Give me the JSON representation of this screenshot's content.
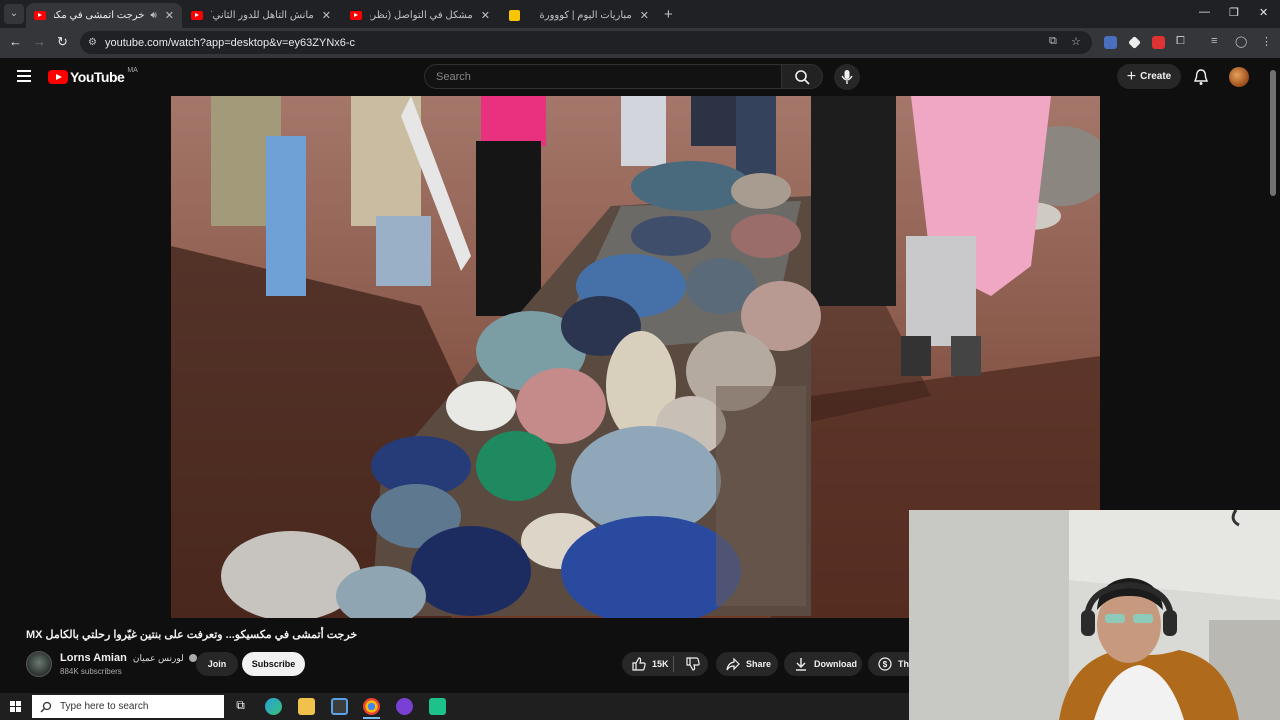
{
  "browser": {
    "tabs": [
      {
        "title": "خرجت أتمشى في مكسيكو...",
        "active": true,
        "icon": "youtube-icon",
        "audio": true
      },
      {
        "title": "مانش التأهل للدور الثاني؟ التشكيل",
        "active": false,
        "icon": "youtube-icon",
        "audio": false
      },
      {
        "title": "مشكل في التواصل (نظرية البراق)",
        "active": false,
        "icon": "youtube-icon",
        "audio": false
      },
      {
        "title": "مباريات اليوم | كووورة",
        "active": false,
        "icon": "kooora-icon",
        "audio": false
      }
    ],
    "url": "youtube.com/watch?app=desktop&v=ey63ZYNx6-c"
  },
  "youtube": {
    "logo_text": "YouTube",
    "country_code": "MA",
    "search_placeholder": "Search",
    "create_label": "Create"
  },
  "video": {
    "title": "خرجت أتمشى في مكسيكو... وتعرفت على بنتين غيّروا رحلتي بالكامل MX",
    "channel_name": "Lorns Amian",
    "channel_name_ar": "لورنس عميان",
    "subscribers": "884K subscribers",
    "join_label": "Join",
    "subscribe_label": "Subscribe",
    "likes": "15K",
    "share_label": "Share",
    "download_label": "Download",
    "thanks_label": "Thanks"
  },
  "taskbar": {
    "search_placeholder": "Type here to search"
  },
  "colors": {
    "youtube_red": "#ff0000",
    "chrome_dark": "#202124",
    "page_bg": "#0f0f0f"
  }
}
